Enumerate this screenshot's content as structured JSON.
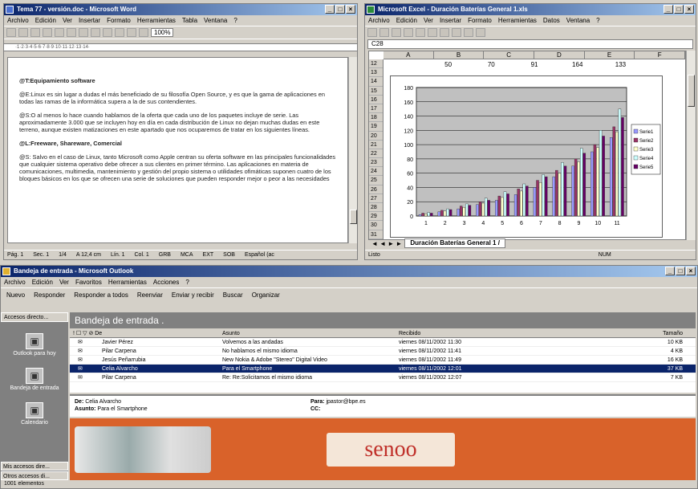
{
  "word": {
    "title": "Tema 77 - versión.doc - Microsoft Word",
    "menu": [
      "Archivo",
      "Edición",
      "Ver",
      "Insertar",
      "Formato",
      "Herramientas",
      "Tabla",
      "Ventana",
      "?"
    ],
    "zoom": "100%",
    "ruler": "·1·2·3·4·5·6·7·8·9·10·11·12·13·14·",
    "paragraphs": [
      {
        "text": "@T:Equipamiento software",
        "heading": true
      },
      {
        "text": "@E:Linux es sin lugar a dudas el más beneficiado de su filosofía Open Source, y es que la gama de aplicaciones en todas las ramas de la informática supera a la de sus contendientes."
      },
      {
        "text": "@S:O al menos lo hace cuando hablamos de la oferta que cada uno de los paquetes incluye de serie. Las aproximadamente 3.000 que se incluyen hoy en día en cada distribución de Linux no dejan muchas dudas en este terreno, aunque existen matizaciones en este apartado que nos ocuparemos de tratar en los siguientes líneas."
      },
      {
        "text": "@L:Freeware, Shareware, Comercial",
        "heading": true
      },
      {
        "text": "@S: Salvo en el caso de Linux, tanto Microsoft como Apple centran su oferta software en las principales funcionalidades que cualquier sistema operativo debe ofrecer a sus clientes en primer término. Las aplicaciones en materia de comunicaciones, multimedia, mantenimiento y gestión del propio sistema o utilidades ofimáticas suponen cuatro de los bloques básicos en los que se ofrecen una serie de soluciones que pueden responder mejor o peor a las necesidades"
      }
    ],
    "status": [
      "Pág. 1",
      "Sec. 1",
      "1/4",
      "A 12,4 cm",
      "Lín. 1",
      "Col. 1",
      "GRB",
      "MCA",
      "EXT",
      "SOB",
      "Español (ac"
    ]
  },
  "excel": {
    "title": "Microsoft Excel - Duración Baterías General 1.xls",
    "menu": [
      "Archivo",
      "Edición",
      "Ver",
      "Insertar",
      "Formato",
      "Herramientas",
      "Datos",
      "Ventana",
      "?"
    ],
    "namebox": "C28",
    "columns": [
      "A",
      "B",
      "C",
      "D",
      "E",
      "F"
    ],
    "row12": [
      "",
      "50",
      "70",
      "91",
      "164",
      "133",
      ""
    ],
    "rows": [
      "12",
      "13",
      "14",
      "15",
      "16",
      "17",
      "18",
      "19",
      "20",
      "21",
      "22",
      "23",
      "24",
      "25",
      "26",
      "27",
      "28",
      "29",
      "30",
      "31"
    ],
    "sheet_tab": "Duración Baterías General 1 /",
    "status": "Listo",
    "status_right": "NUM"
  },
  "chart_data": {
    "type": "bar",
    "categories": [
      "1",
      "2",
      "3",
      "4",
      "5",
      "6",
      "7",
      "8",
      "9",
      "10",
      "11"
    ],
    "series": [
      {
        "name": "Serie1",
        "color": "#9999ff",
        "values": [
          2,
          6,
          10,
          16,
          22,
          30,
          40,
          55,
          70,
          90,
          110
        ]
      },
      {
        "name": "Serie2",
        "color": "#993366",
        "values": [
          4,
          8,
          14,
          20,
          28,
          38,
          50,
          64,
          80,
          100,
          125
        ]
      },
      {
        "name": "Serie3",
        "color": "#ffffcc",
        "values": [
          3,
          7,
          12,
          18,
          26,
          35,
          47,
          60,
          76,
          96,
          118
        ]
      },
      {
        "name": "Serie4",
        "color": "#ccffff",
        "values": [
          5,
          10,
          17,
          25,
          34,
          45,
          58,
          75,
          95,
          120,
          150
        ]
      },
      {
        "name": "Serie5",
        "color": "#660066",
        "values": [
          4,
          9,
          15,
          22,
          31,
          42,
          55,
          70,
          88,
          112,
          138
        ]
      }
    ],
    "ylim": [
      0,
      180
    ],
    "yticks": [
      "0",
      "20",
      "40",
      "60",
      "80",
      "100",
      "120",
      "140",
      "160",
      "180"
    ],
    "grid": true,
    "legend": "right"
  },
  "outlook": {
    "title": "Bandeja de entrada - Microsoft Outlook",
    "menu": [
      "Archivo",
      "Edición",
      "Ver",
      "Favoritos",
      "Herramientas",
      "Acciones",
      "?"
    ],
    "toolbar": [
      "Nuevo",
      "Responder",
      "Responder a todos",
      "Reenviar",
      "Enviar y recibir",
      "Buscar",
      "Organizar"
    ],
    "sidebar_head": "Accesos directo...",
    "sidebar_items": [
      "Outlook para hoy",
      "Bandeja de entrada",
      "Calendario"
    ],
    "sidebar_foot": [
      "Mis accesos dire...",
      "Otros accesos di..."
    ],
    "folder": "Bandeja de entrada .",
    "headers": [
      "! ☐ ▽ ⊘ De",
      "Asunto",
      "Recibido",
      "Tamaño"
    ],
    "messages": [
      {
        "from": "Javier Pérez",
        "subject": "Volvemos a las andadas",
        "date": "viernes 08/11/2002 11:30",
        "size": "10 KB",
        "sel": false
      },
      {
        "from": "Pilar Carpena",
        "subject": "No hablamos el mismo idioma",
        "date": "viernes 08/11/2002 11:41",
        "size": "4 KB",
        "sel": false
      },
      {
        "from": "Jesús Peñarrubia",
        "subject": "New Nokia & Adobe \"Stereo\" Digital Video",
        "date": "viernes 08/11/2002 11:49",
        "size": "16 KB",
        "sel": false
      },
      {
        "from": "Celia Alvarcho",
        "subject": "Para el Smartphone",
        "date": "viernes 08/11/2002 12:01",
        "size": "37 KB",
        "sel": true
      },
      {
        "from": "Pilar Carpena",
        "subject": "Re: Re:Solicitamos el mismo idioma",
        "date": "viernes 08/11/2002 12:07",
        "size": "7 KB",
        "sel": false
      }
    ],
    "preview_from_label": "De:",
    "preview_from": "Celia Alvarcho",
    "preview_subject_label": "Asunto:",
    "preview_subject": "Para el Smartphone",
    "preview_to_label": "Para:",
    "preview_to": "jpastor@bpe.es",
    "preview_cc_label": "CC:",
    "logo": "senoo",
    "footer": "1001 elementos"
  }
}
